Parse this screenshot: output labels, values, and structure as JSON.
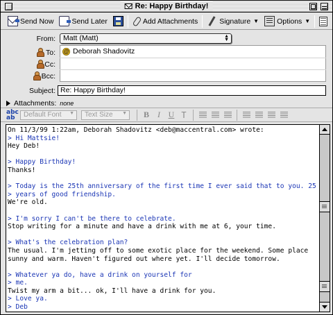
{
  "window": {
    "title": "Re: Happy Birthday!"
  },
  "toolbar": {
    "send_now": "Send Now",
    "send_later": "Send Later",
    "add_attachments": "Add Attachments",
    "signature": "Signature",
    "options": "Options"
  },
  "header": {
    "from_label": "From:",
    "from_value": "Matt (Matt)",
    "to_label": "To:",
    "to_value": "Deborah Shadovitz",
    "cc_label": "Cc:",
    "bcc_label": "Bcc:",
    "subject_label": "Subject:",
    "subject_value": "Re: Happy Birthday!",
    "attachments_label": "Attachments:",
    "attachments_value": "none"
  },
  "format_bar": {
    "font": "Default Font",
    "size": "Text Size",
    "bold": "B",
    "italic": "I",
    "underline": "U",
    "teletype": "T"
  },
  "body": {
    "lines": [
      {
        "text": "On 11/3/99 1:22am, Deborah Shadovitz <deb@maccentral.com> wrote:",
        "quote": false
      },
      {
        "text": "> Hi Mattsie!",
        "quote": true
      },
      {
        "text": "Hey Deb!",
        "quote": false
      },
      {
        "text": "",
        "quote": false
      },
      {
        "text": "> Happy Birthday!",
        "quote": true
      },
      {
        "text": "Thanks!",
        "quote": false
      },
      {
        "text": "",
        "quote": false
      },
      {
        "text": "> Today is the 25th anniversary of the first time I ever said that to you. 25",
        "quote": true
      },
      {
        "text": "> years of good friendship.",
        "quote": true
      },
      {
        "text": "We're old.",
        "quote": false
      },
      {
        "text": "",
        "quote": false
      },
      {
        "text": "> I'm sorry I can't be there to celebrate.",
        "quote": true
      },
      {
        "text": "Stop writing for a minute and have a drink with me at 6, your time.",
        "quote": false
      },
      {
        "text": "",
        "quote": false
      },
      {
        "text": "> What's the celebration plan?",
        "quote": true
      },
      {
        "text": "The usual. I'm jetting off to some exotic place for the weekend. Some place",
        "quote": false
      },
      {
        "text": "sunny and warm. Haven't figured out where yet. I'll decide tomorrow.",
        "quote": false
      },
      {
        "text": "",
        "quote": false
      },
      {
        "text": "> Whatever ya do, have a drink on yourself for",
        "quote": true
      },
      {
        "text": "> me.",
        "quote": true
      },
      {
        "text": "Twist my arm a bit... ok, I'll have a drink for you.",
        "quote": false
      },
      {
        "text": "> Love ya.",
        "quote": true
      },
      {
        "text": "> Deb",
        "quote": true
      }
    ]
  },
  "colors": {
    "quote": "#1a35b5",
    "chrome": "#e4e4e4"
  }
}
